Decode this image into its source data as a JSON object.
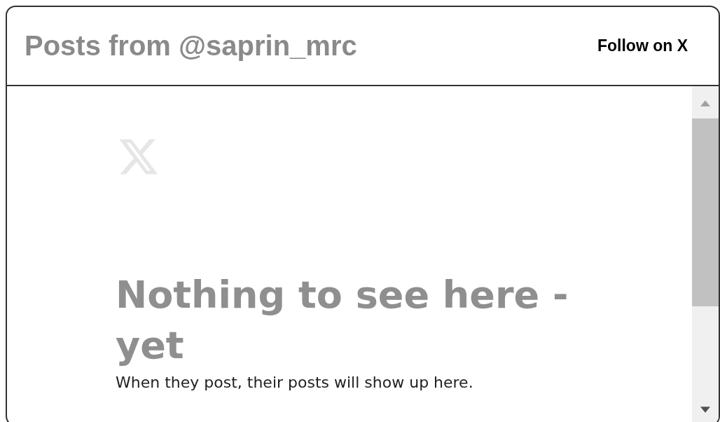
{
  "header": {
    "title": "Posts from @saprin_mrc",
    "follow_link": "Follow on X"
  },
  "empty_state": {
    "heading": "Nothing to see here - yet",
    "message": "When they post, their posts will show up here."
  }
}
